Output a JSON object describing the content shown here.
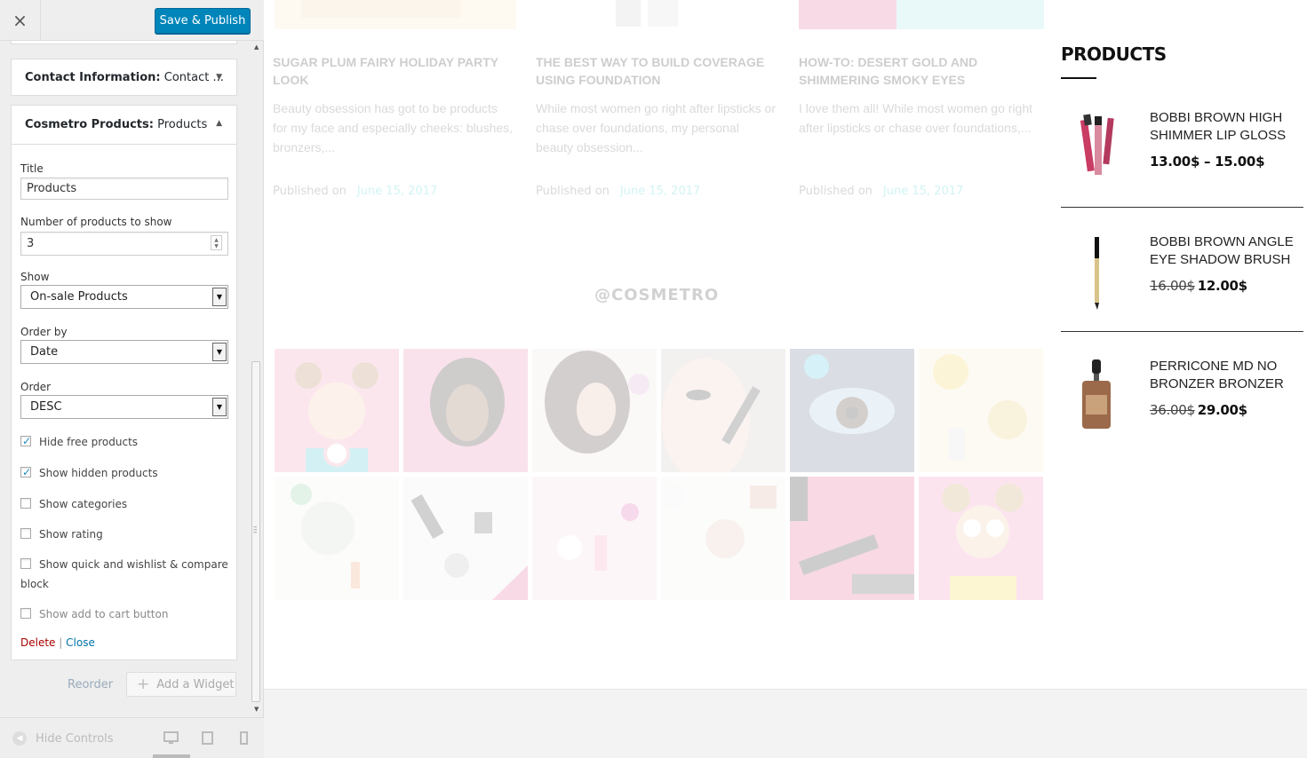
{
  "customizer": {
    "publish_label": "Save & Publish",
    "close_glyph": "×",
    "sections": {
      "contact": {
        "prefix": "Contact Information:",
        "value": "Contact ..."
      },
      "products": {
        "prefix": "Cosmetro Products:",
        "value": "Products"
      }
    },
    "form": {
      "title_label": "Title",
      "title_value": "Products",
      "count_label": "Number of products to show",
      "count_value": "3",
      "show_label": "Show",
      "show_value": "On-sale Products",
      "orderby_label": "Order by",
      "orderby_value": "Date",
      "order_label": "Order",
      "order_value": "DESC",
      "checkboxes": [
        {
          "label": "Hide free products",
          "checked": true
        },
        {
          "label": "Show hidden products",
          "checked": true
        },
        {
          "label": "Show categories",
          "checked": false
        },
        {
          "label": "Show rating",
          "checked": false
        },
        {
          "label": "Show quick and wishlist & compare block",
          "checked": false
        },
        {
          "label": "Show add to cart button",
          "checked": false
        }
      ],
      "delete_label": "Delete",
      "link_separator": "|",
      "close_label": "Close"
    },
    "reorder_label": "Reorder",
    "add_widget_label": "Add a Widget",
    "hide_controls_label": "Hide Controls"
  },
  "preview": {
    "posts": [
      {
        "title": "Sugar Plum Fairy Holiday Party Look",
        "excerpt": "Beauty obsession has got to be products for my face and especially cheeks: blushes, bronzers,...",
        "meta": "Published on",
        "date": "June 15, 2017"
      },
      {
        "title": "The Best Way to Build Coverage Using Foundation",
        "excerpt": "While most women go right after lipsticks or chase over foundations, my personal beauty obsession...",
        "meta": "Published on",
        "date": "June 15, 2017"
      },
      {
        "title": "How-To: Desert Gold and Shimmering Smoky Eyes",
        "excerpt": "I love them all! While most women go right after lipsticks or chase over foundations,...",
        "meta": "Published on",
        "date": "June 15, 2017"
      }
    ],
    "instagram_handle": "@COSMETRO",
    "products_widget": {
      "title": "Products",
      "items": [
        {
          "name": "Bobbi Brown High Shimmer Lip Gloss",
          "price_old": "",
          "price": "13.00$ – 15.00$"
        },
        {
          "name": "Bobbi Brown Angle Eye Shadow Brush",
          "price_old": "16.00$",
          "price": "12.00$"
        },
        {
          "name": "Perricone MD No Bronzer Bronzer",
          "price_old": "36.00$",
          "price": "29.00$"
        }
      ]
    }
  },
  "colors": {
    "publish": "#0085ba",
    "delete": "#aa0000",
    "link": "#0073aa",
    "accent": "#33cccc"
  }
}
